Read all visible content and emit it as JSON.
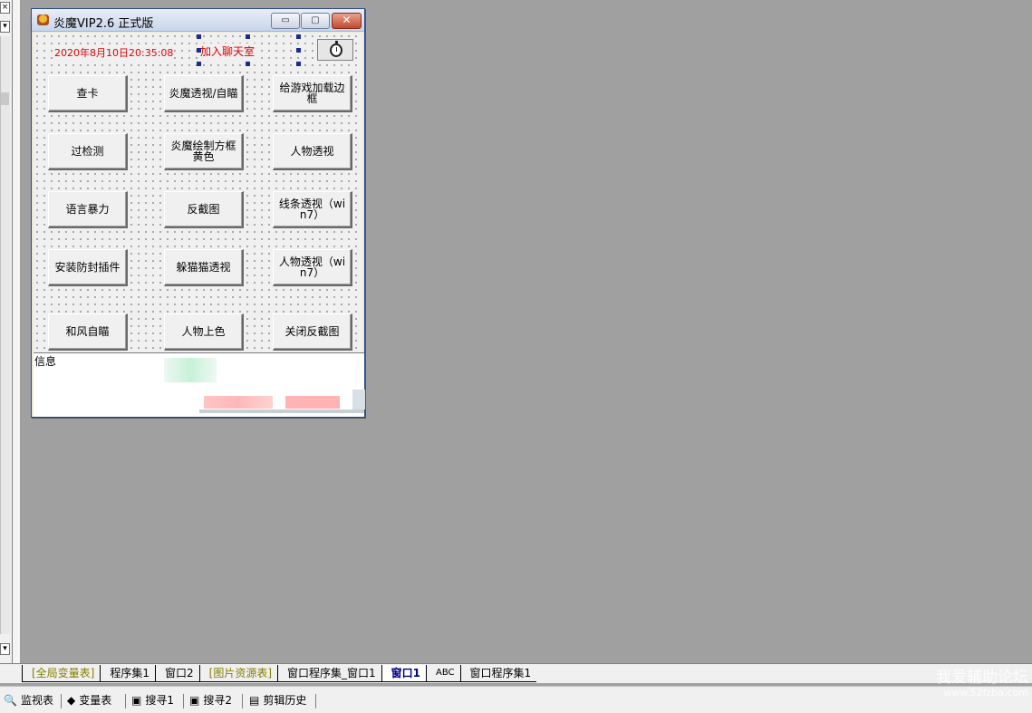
{
  "window": {
    "title": "炎魔VIP2.6 正式版",
    "min_label": "▭",
    "max_label": "▢",
    "close_label": "✕"
  },
  "header": {
    "datetime": "2020年8月10日20:35:08",
    "chat_link": "加入聊天室"
  },
  "buttons": [
    "查卡",
    "炎魔透视/自瞄",
    "给游戏加载边框",
    "过检测",
    "炎魔绘制方框黄色",
    "人物透视",
    "语言暴力",
    "反截图",
    "线条透视（win7）",
    "安装防封插件",
    "躲猫猫透视",
    "人物透视（win7）",
    "和风自瞄",
    "人物上色",
    "关闭反截图"
  ],
  "info": {
    "label": "信息"
  },
  "tabs": [
    {
      "label": "[全局变量表]",
      "kind": "special"
    },
    {
      "label": "程序集1",
      "kind": "normal"
    },
    {
      "label": "窗口2",
      "kind": "normal"
    },
    {
      "label": "[图片资源表]",
      "kind": "special"
    },
    {
      "label": "窗口程序集_窗口1",
      "kind": "normal"
    },
    {
      "label": "窗口1",
      "kind": "active"
    },
    {
      "label": "ABC",
      "kind": "small"
    },
    {
      "label": "窗口程序集1",
      "kind": "normal"
    }
  ],
  "statusbar": {
    "watch": "监视表",
    "vars": "变量表",
    "search1": "搜寻1",
    "search2": "搜寻2",
    "clip": "剪辑历史"
  },
  "watermark": {
    "line1": "我爱辅助论坛",
    "line2": "www.52fzba.com"
  },
  "left_strip": {
    "top_btn": "×",
    "arrow": "▾"
  }
}
